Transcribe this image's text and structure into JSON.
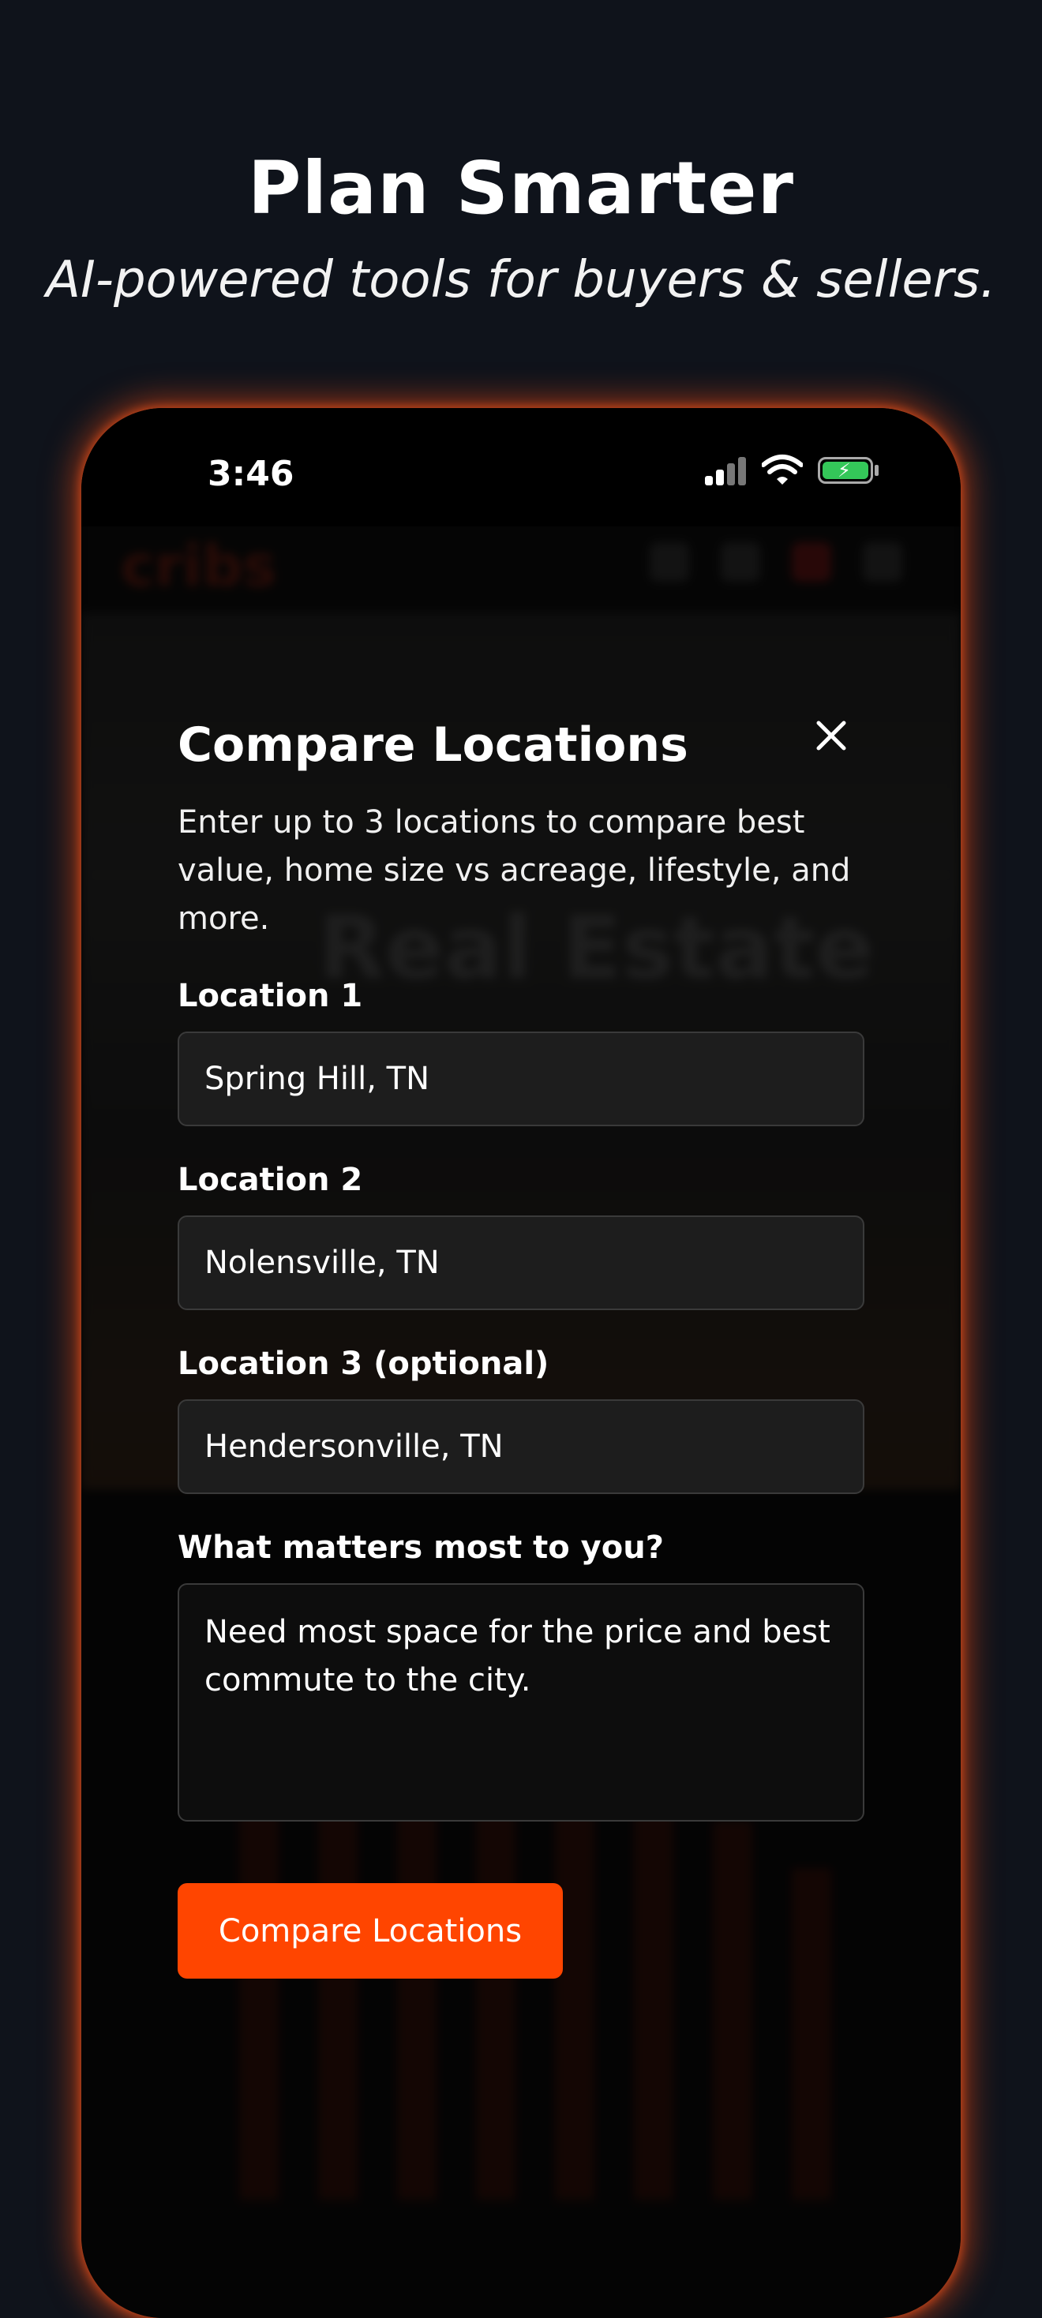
{
  "hero": {
    "title": "Plan Smarter",
    "subtitle": "AI-powered tools for buyers & sellers."
  },
  "status_bar": {
    "time": "3:46",
    "icons": [
      "cellular-signal-icon",
      "wifi-icon",
      "battery-charging-icon"
    ]
  },
  "modal": {
    "title": "Compare Locations",
    "description": "Enter up to 3 locations to compare best value, home size vs acreage, lifestyle, and more.",
    "close_icon": "close-icon",
    "fields": [
      {
        "label": "Location 1",
        "value": "Spring Hill, TN"
      },
      {
        "label": "Location 2",
        "value": "Nolensville, TN"
      },
      {
        "label": "Location 3 (optional)",
        "value": "Hendersonville, TN"
      }
    ],
    "priorities": {
      "label": "What matters most to you?",
      "value": "Need most space for the price and best commute to the city."
    },
    "submit_label": "Compare Locations"
  },
  "colors": {
    "accent": "#ff4500",
    "background": "#0f131b",
    "field_bg": "#1d1d1d",
    "battery": "#34c759"
  }
}
